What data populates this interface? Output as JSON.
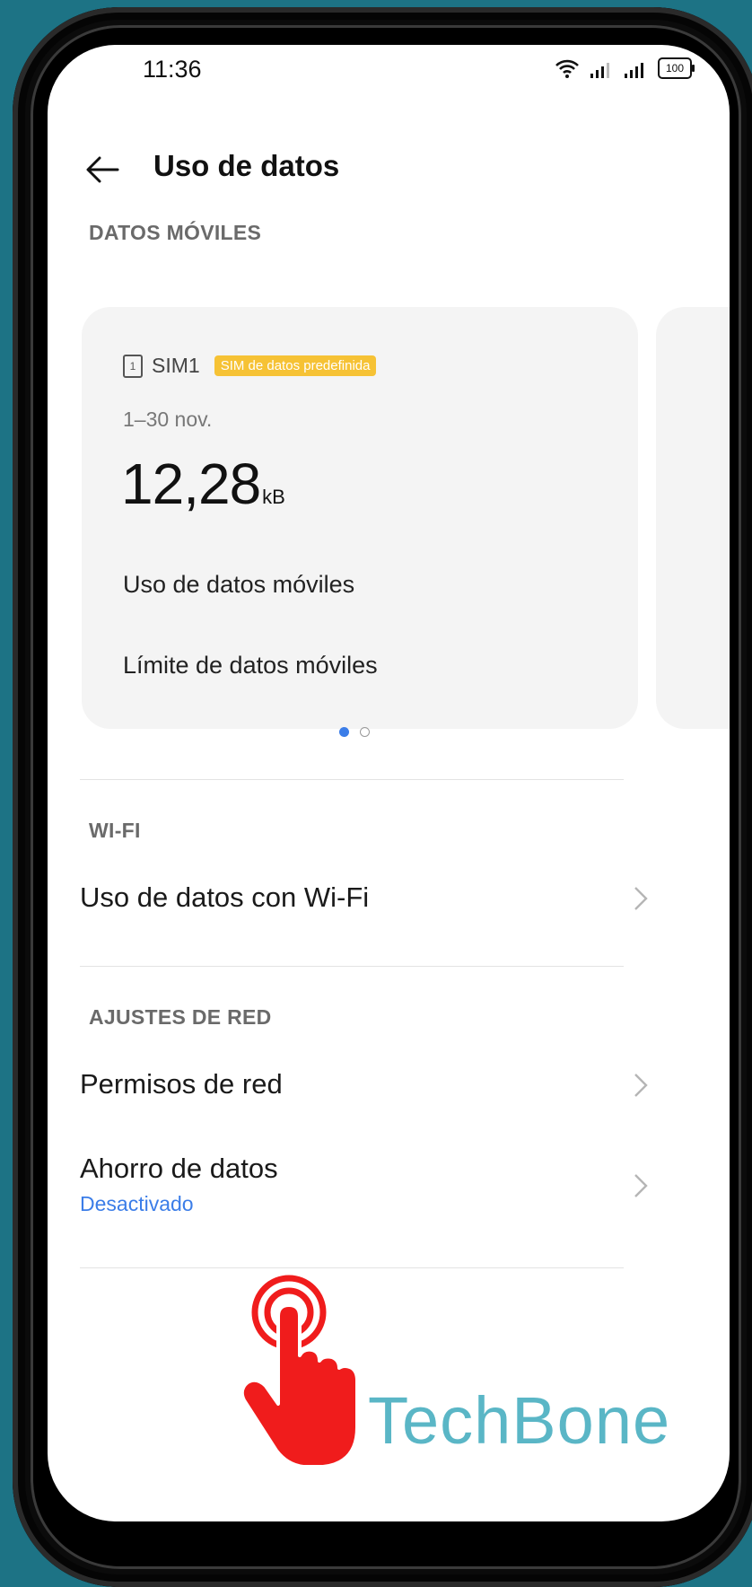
{
  "status_bar": {
    "time": "11:36",
    "battery": "100"
  },
  "header": {
    "title": "Uso de datos"
  },
  "mobile_section": {
    "label": "DATOS MÓVILES",
    "sim": {
      "slot": "1",
      "name": "SIM1",
      "badge": "SIM de datos predefinida",
      "period": "1–30 nov.",
      "usage_value": "12,28",
      "usage_unit": "kB",
      "links": [
        "Uso de datos móviles",
        "Límite de datos móviles"
      ]
    }
  },
  "wifi_section": {
    "label": "WI-FI",
    "items": [
      {
        "title": "Uso de datos con Wi-Fi"
      }
    ]
  },
  "network_section": {
    "label": "AJUSTES DE RED",
    "items": [
      {
        "title": "Permisos de red"
      },
      {
        "title": "Ahorro de datos",
        "subtitle": "Desactivado"
      }
    ]
  },
  "watermark": "TechBone",
  "colors": {
    "accent": "#3b7de8",
    "badge": "#f6c235",
    "background": "#1d7385",
    "pointer": "#f01c1c"
  }
}
